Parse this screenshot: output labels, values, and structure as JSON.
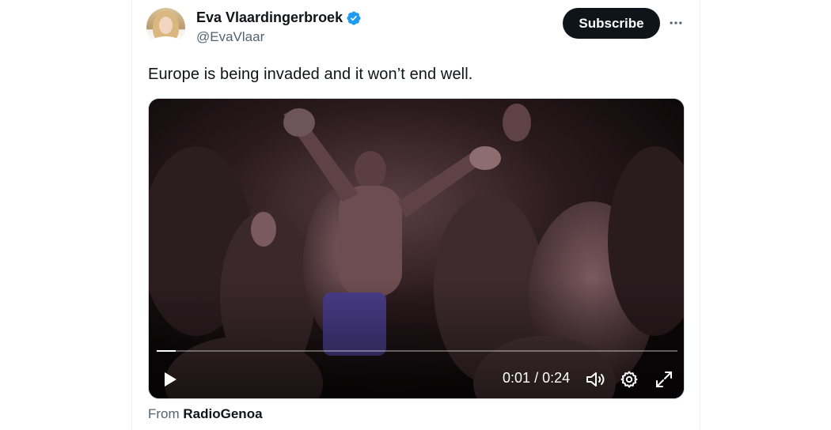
{
  "author": {
    "display_name": "Eva Vlaardingerbroek",
    "handle": "@EvaVlaar",
    "verified_icon": "verified-badge-icon",
    "avatar": "profile-photo"
  },
  "actions": {
    "subscribe_label": "Subscribe",
    "more_icon": "more-dots-icon"
  },
  "tweet": {
    "text": "Europe is being invaded and it won’t end well."
  },
  "video": {
    "current_time": "0:01",
    "separator": "/",
    "duration": "0:24",
    "progress_fraction": 0.037,
    "icons": {
      "play": "play-icon",
      "volume": "volume-icon",
      "settings": "settings-gear-icon",
      "fullscreen": "fullscreen-icon"
    }
  },
  "attribution": {
    "prefix": "From",
    "source": "RadioGenoa"
  },
  "colors": {
    "verified": "#1d9bf0",
    "button_bg": "#0f1419",
    "secondary_text": "#536471"
  }
}
